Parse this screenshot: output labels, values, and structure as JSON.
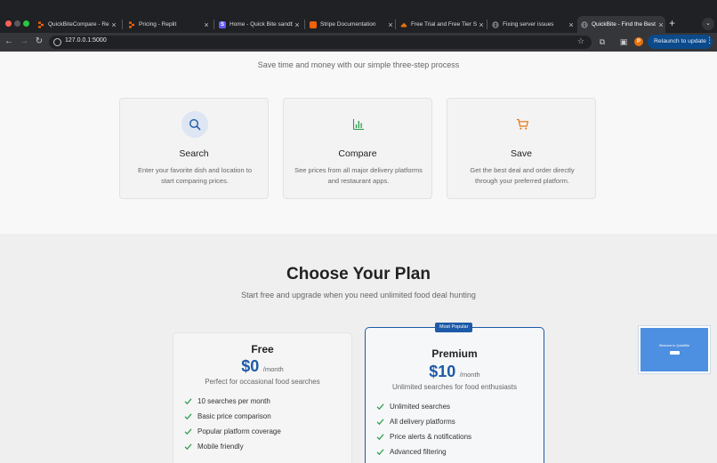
{
  "browser": {
    "tabs": [
      {
        "title": "QuickBiteCompare - Repli",
        "icon": "replit-icon",
        "color": "#f26207"
      },
      {
        "title": "Pricing - Replit",
        "icon": "replit-icon",
        "color": "#f26207"
      },
      {
        "title": "Home - Quick Bite sandb",
        "icon": "stripe-icon",
        "color": "#635bff",
        "glyph": "S"
      },
      {
        "title": "Stripe Documentation",
        "icon": "stripe-docs-icon",
        "color": "#f26207"
      },
      {
        "title": "Free Trial and Free Tier Se",
        "icon": "cloud-icon",
        "color": "#e8710a"
      },
      {
        "title": "Fixing server issues",
        "icon": "globe-icon",
        "color": "#9aa0a6"
      },
      {
        "title": "QuickBite - Find the Best D",
        "icon": "globe-icon",
        "color": "#9aa0a6",
        "active": true
      }
    ],
    "url": "127.0.0.1:5000",
    "profile_initial": "P",
    "relaunch_label": "Relaunch to update"
  },
  "how": {
    "subtitle": "Save time and money with our simple three-step process",
    "steps": [
      {
        "title": "Search",
        "desc": "Enter your favorite dish and location to start comparing prices.",
        "icon": "search-icon",
        "color": "#1e5aa8"
      },
      {
        "title": "Compare",
        "desc": "See prices from all major delivery platforms and restaurant apps.",
        "icon": "bar-chart-icon",
        "color": "#2a9d4a"
      },
      {
        "title": "Save",
        "desc": "Get the best deal and order directly through your preferred platform.",
        "icon": "cart-icon",
        "color": "#e8710a"
      }
    ]
  },
  "plans": {
    "title": "Choose Your Plan",
    "subtitle": "Start free and upgrade when you need unlimited food deal hunting",
    "free": {
      "name": "Free",
      "price": "$0",
      "period": "/month",
      "desc": "Perfect for occasional food searches",
      "features": [
        "10 searches per month",
        "Basic price comparison",
        "Popular platform coverage",
        "Mobile friendly"
      ]
    },
    "premium": {
      "badge": "Most Popular",
      "name": "Premium",
      "price": "$10",
      "period": "/month",
      "desc": "Unlimited searches for food enthusiasts",
      "features": [
        "Unlimited searches",
        "All delivery platforms",
        "Price alerts & notifications",
        "Advanced filtering"
      ]
    }
  },
  "thumbnail": {
    "title": "Welcome to QuickBite"
  },
  "colors": {
    "accent": "#1e5aa8",
    "check": "#2a9d4a"
  }
}
